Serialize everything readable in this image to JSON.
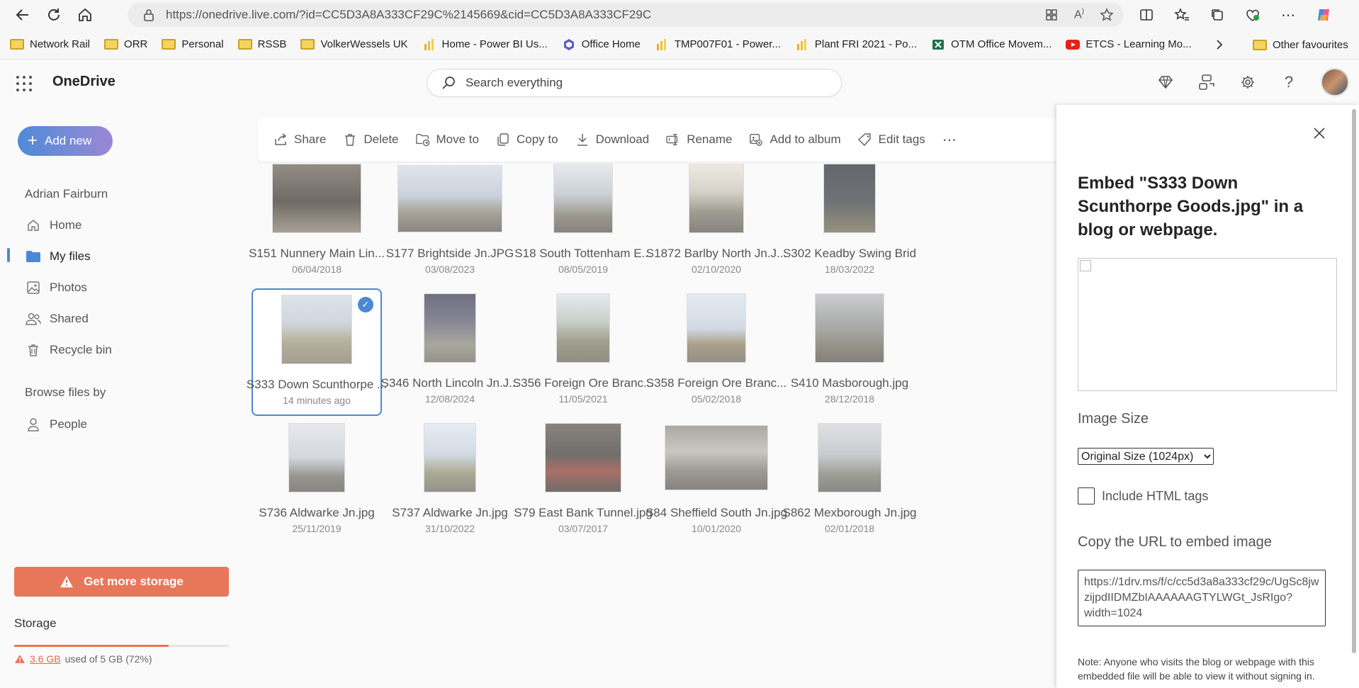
{
  "browser": {
    "url": "https://onedrive.live.com/?id=CC5D3A8A333CF29C%2145669&cid=CC5D3A8A333CF29C",
    "favourites": [
      {
        "label": "Network Rail",
        "icon": "folder-icon"
      },
      {
        "label": "ORR",
        "icon": "folder-icon"
      },
      {
        "label": "Personal",
        "icon": "folder-icon"
      },
      {
        "label": "RSSB",
        "icon": "folder-icon"
      },
      {
        "label": "VolkerWessels UK",
        "icon": "folder-icon"
      },
      {
        "label": "Home - Power BI Us...",
        "icon": "powerbi-icon"
      },
      {
        "label": "Office Home",
        "icon": "office-icon"
      },
      {
        "label": "TMP007F01 - Power...",
        "icon": "powerbi-icon"
      },
      {
        "label": "Plant FRI 2021 - Po...",
        "icon": "powerbi-icon"
      },
      {
        "label": "OTM Office Movem...",
        "icon": "excel-icon"
      },
      {
        "label": "ETCS - Learning Mo...",
        "icon": "youtube-icon"
      }
    ],
    "other_favourites": "Other favourites"
  },
  "header": {
    "app_name": "OneDrive",
    "search_placeholder": "Search everything"
  },
  "nav": {
    "add_new": "Add new",
    "user": "Adrian Fairburn",
    "items": [
      {
        "label": "Home",
        "icon": "home-icon"
      },
      {
        "label": "My files",
        "icon": "folder-icon"
      },
      {
        "label": "Photos",
        "icon": "photo-icon"
      },
      {
        "label": "Shared",
        "icon": "people-icon"
      },
      {
        "label": "Recycle bin",
        "icon": "trash-icon"
      }
    ],
    "browse_by": "Browse files by",
    "people": "People",
    "get_storage": "Get more storage",
    "storage_label": "Storage",
    "storage_used": "3.6 GB",
    "storage_rest": "used of 5 GB (72%)",
    "storage_fraction": 0.72
  },
  "commands": [
    "Share",
    "Delete",
    "Move to",
    "Copy to",
    "Download",
    "Rename",
    "Add to album",
    "Edit tags"
  ],
  "files": [
    {
      "name": "S151 Nunnery Main Lin...",
      "date": "06/04/2018"
    },
    {
      "name": "S177 Brightside Jn.JPG",
      "date": "03/08/2023"
    },
    {
      "name": "S18 South Tottenham E...",
      "date": "08/05/2019"
    },
    {
      "name": "S1872 Barlby North Jn.J...",
      "date": "02/10/2020"
    },
    {
      "name": "S302 Keadby Swing Brid",
      "date": "18/03/2022"
    },
    {
      "name": "S333 Down Scunthorpe ...",
      "date": "14 minutes ago"
    },
    {
      "name": "S346 North Lincoln Jn.J...",
      "date": "12/08/2024"
    },
    {
      "name": "S356 Foreign Ore Branc...",
      "date": "11/05/2021"
    },
    {
      "name": "S358 Foreign Ore Branc...",
      "date": "05/02/2018"
    },
    {
      "name": "S410 Masborough.jpg",
      "date": "28/12/2018"
    },
    {
      "name": "S736 Aldwarke Jn.jpg",
      "date": "25/11/2019"
    },
    {
      "name": "S737 Aldwarke Jn.jpg",
      "date": "31/10/2022"
    },
    {
      "name": "S79 East Bank Tunnel.jpg",
      "date": "03/07/2017"
    },
    {
      "name": "S84 Sheffield South Jn.jpg",
      "date": "10/01/2020"
    },
    {
      "name": "S862 Mexborough Jn.jpg",
      "date": "02/01/2018"
    }
  ],
  "panel": {
    "title": "Embed \"S333 Down Scunthorpe Goods.jpg\" in a blog or webpage.",
    "image_size_label": "Image Size",
    "image_size_value": "Original Size (1024px)",
    "include_html": "Include HTML tags",
    "copy_label": "Copy the URL to embed image",
    "embed_url": "https://1drv.ms/f/c/cc5d3a8a333cf29c/UgSc8jwzijpdIIDMZbIAAAAAAGTYLWGt_JsRIgo?width=1024",
    "note": "Note: Anyone who visits the blog or webpage with this embedded file will be able to view it without signing in."
  }
}
